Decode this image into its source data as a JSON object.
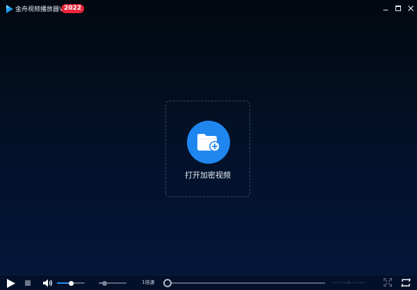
{
  "titlebar": {
    "title": "金舟视频播放器V5.0",
    "badge": "2022",
    "logo_icon": "play-logo-icon",
    "buttons": [
      "minimize-icon",
      "maximize-icon",
      "close-icon"
    ]
  },
  "center": {
    "open_label": "打开加密视频",
    "icon": "folder-add-icon",
    "accent_color": "#1f86f0"
  },
  "controls": {
    "speed_label": "1倍速",
    "time_display": "--:--:--/--:--:--",
    "volume_level": 0.5,
    "speed_level": 0.2,
    "progress": 0,
    "icons": [
      "play-icon",
      "stop-icon",
      "volume-icon",
      "fullscreen-icon",
      "loop-icon"
    ]
  },
  "colors": {
    "badge": "#e8263c",
    "accent": "#2e8ff5",
    "background": "#03163a"
  }
}
